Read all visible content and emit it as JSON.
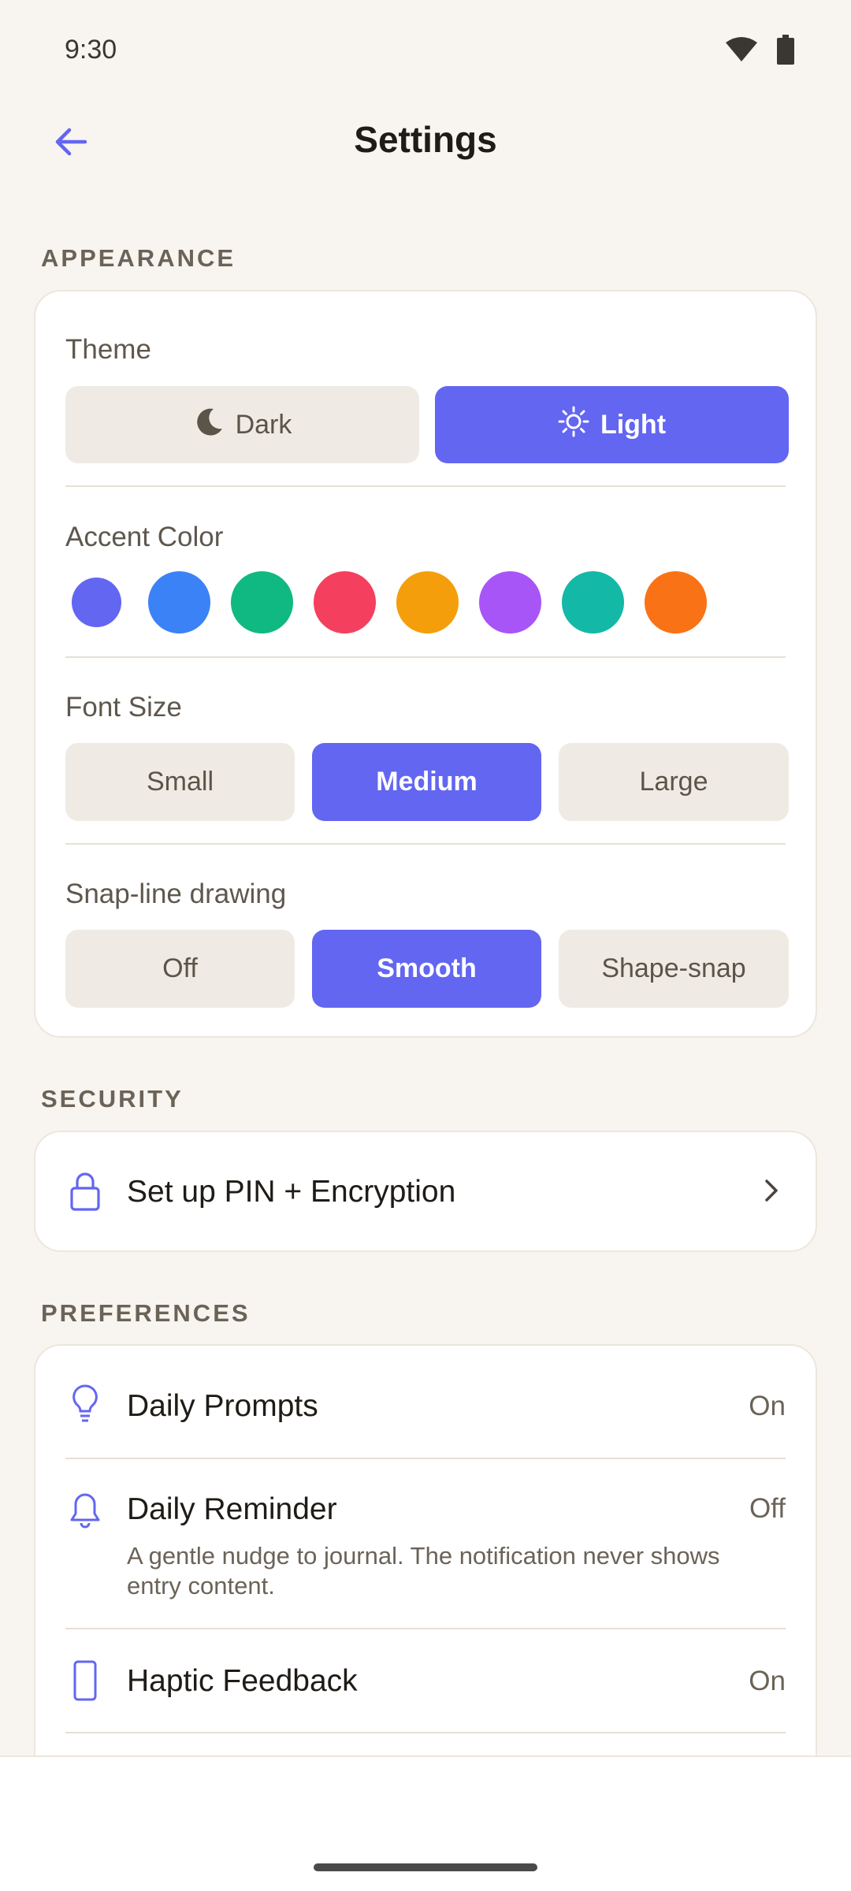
{
  "status_bar": {
    "time": "9:30",
    "icons": [
      "wifi-icon",
      "battery-icon"
    ]
  },
  "app_bar": {
    "title": "Settings",
    "back_icon": "arrow-left-icon"
  },
  "colors": {
    "accent": "#6366f1",
    "background": "#f8f5f0",
    "card": "#ffffff",
    "chip": "#efebe4"
  },
  "appearance": {
    "section_label": "APPEARANCE",
    "theme": {
      "label": "Theme",
      "options": [
        {
          "label": "Dark",
          "icon": "moon-icon",
          "selected": false
        },
        {
          "label": "Light",
          "icon": "sun-icon",
          "selected": true
        }
      ]
    },
    "accent_color": {
      "label": "Accent Color",
      "swatches": [
        "#6366f1",
        "#3b82f6",
        "#10b981",
        "#f43f5e",
        "#f59e0b",
        "#a855f7",
        "#14b8a6",
        "#f97316"
      ],
      "selected": "#6366f1"
    },
    "font_size": {
      "label": "Font Size",
      "options": [
        {
          "label": "Small",
          "selected": false
        },
        {
          "label": "Medium",
          "selected": true
        },
        {
          "label": "Large",
          "selected": false
        }
      ]
    },
    "snap_line": {
      "label": "Snap-line drawing",
      "options": [
        {
          "label": "Off",
          "selected": false
        },
        {
          "label": "Smooth",
          "selected": true
        },
        {
          "label": "Shape-snap",
          "selected": false
        }
      ]
    }
  },
  "security": {
    "section_label": "SECURITY",
    "pin": {
      "label": "Set up PIN + Encryption",
      "icon": "lock-icon",
      "chevron": "chevron-right-icon"
    }
  },
  "preferences": {
    "section_label": "PREFERENCES",
    "items": [
      {
        "label": "Daily Prompts",
        "value": "On",
        "icon": "lightbulb-icon"
      },
      {
        "label": "Daily Reminder",
        "value": "Off",
        "icon": "bell-icon",
        "subtitle": "A gentle nudge to journal. The notification never shows entry content."
      },
      {
        "label": "Haptic Feedback",
        "value": "On",
        "icon": "phone-icon"
      }
    ]
  }
}
